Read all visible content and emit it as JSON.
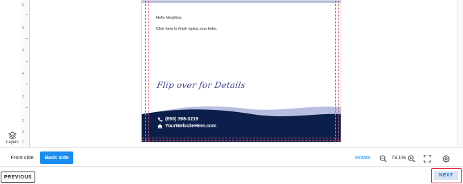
{
  "editor": {
    "ruler_numbers": [
      "5",
      "5",
      "4",
      "4",
      "3",
      "3",
      "2",
      "1"
    ],
    "layers_label": "Layers"
  },
  "card": {
    "greeting": "Hello Neighbor,",
    "body": "Click here to finish typing your letter.",
    "flip_text": "Flip over for Details",
    "phone": "(850) 398-3219",
    "website": "YourWebsiteHere.com",
    "colors": {
      "navy": "#0c1f4a",
      "lavender": "#b9bde0",
      "guide": "#e35a6a"
    }
  },
  "toolbar": {
    "front_tab": "Front side",
    "back_tab": "Back side",
    "rotate_label": "Rotate",
    "zoom_value": "73.1%"
  },
  "footer": {
    "previous_label": "PREVIOUS",
    "next_label": "NEXT"
  },
  "icons": [
    "layers-icon",
    "phone-icon",
    "home-icon",
    "zoom-out-icon",
    "zoom-in-icon",
    "fullscreen-icon",
    "settings-icon"
  ]
}
